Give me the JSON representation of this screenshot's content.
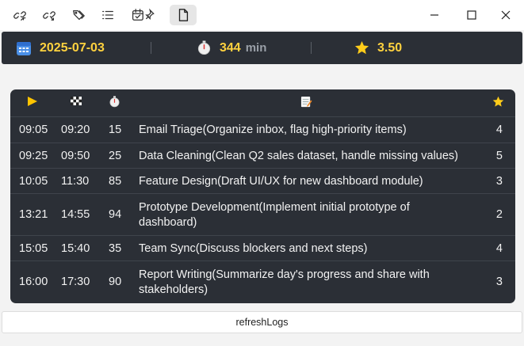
{
  "toolbar": {
    "icons": [
      "link-in-icon",
      "link-out-icon",
      "tags-icon",
      "list-icon",
      "calendar-pin-icon",
      "file-icon"
    ],
    "active_icon": "file-icon"
  },
  "window_controls": [
    "minimize-icon",
    "maximize-icon",
    "close-icon"
  ],
  "stats": {
    "date": "2025-07-03",
    "duration_value": "344",
    "duration_unit": "min",
    "rating": "3.50",
    "icons": [
      "calendar-icon",
      "stopwatch-icon",
      "star-icon"
    ]
  },
  "log": {
    "headers": [
      "start-icon",
      "finish-flag-icon",
      "duration-icon",
      "memo-icon",
      "rating-star-icon"
    ],
    "rows": [
      {
        "start": "09:05",
        "end": "09:20",
        "duration": "15",
        "task": "Email Triage(Organize inbox, flag high-priority items)",
        "rating": "4"
      },
      {
        "start": "09:25",
        "end": "09:50",
        "duration": "25",
        "task": "Data Cleaning(Clean Q2 sales dataset, handle missing values)",
        "rating": "5"
      },
      {
        "start": "10:05",
        "end": "11:30",
        "duration": "85",
        "task": "Feature Design(Draft UI/UX for new dashboard module)",
        "rating": "3"
      },
      {
        "start": "13:21",
        "end": "14:55",
        "duration": "94",
        "task": "Prototype Development(Implement initial prototype of dashboard)",
        "rating": "2"
      },
      {
        "start": "15:05",
        "end": "15:40",
        "duration": "35",
        "task": "Team Sync(Discuss blockers and next steps)",
        "rating": "4"
      },
      {
        "start": "16:00",
        "end": "17:30",
        "duration": "90",
        "task": "Report Writing(Summarize day's progress and share with stakeholders)",
        "rating": "3"
      }
    ]
  },
  "footer": {
    "refresh_label": "refreshLogs"
  },
  "colors": {
    "accent": "#ffd23f",
    "panel": "#2b2f36",
    "text": "#f2f2f2"
  }
}
